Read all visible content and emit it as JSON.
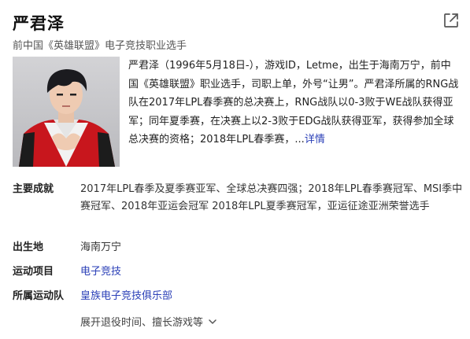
{
  "header": {
    "title": "严君泽",
    "subtitle": "前中国《英雄联盟》电子竞技职业选手"
  },
  "summary": {
    "text": "严君泽（1996年5月18日-），游戏ID，Letme，出生于海南万宁，前中国《英雄联盟》职业选手，司职上单，外号“让男”。严君泽所属的RNG战队在2017年LPL春季赛的总决赛上，RNG战队以0-3败于WE战队获得亚军；同年夏季赛，在决赛上以2-3败于EDG战队获得亚军，获得参加全球总决赛的资格；2018年LPL春季赛，...",
    "more_label": "详情"
  },
  "facts": [
    {
      "label": "主要成就",
      "value": "2017年LPL春季及夏季赛亚军、全球总决赛四强；2018年LPL春季赛冠军、MSI季中赛冠军、2018年亚运会冠军 2018年LPL夏季赛冠军，亚运征途亚洲荣誉选手"
    },
    {
      "label": "出生地",
      "value": "海南万宁"
    },
    {
      "label": "运动项目",
      "value": "电子竞技"
    },
    {
      "label": "所属运动队",
      "value": "皇族电子竞技俱乐部"
    }
  ],
  "expand_label": "展开退役时间、擅长游戏等",
  "colors": {
    "link": "#2a3fb7",
    "jacket": "#c8161d"
  },
  "icons": {
    "share": "share-external-icon",
    "expand": "chevron-down-icon"
  }
}
